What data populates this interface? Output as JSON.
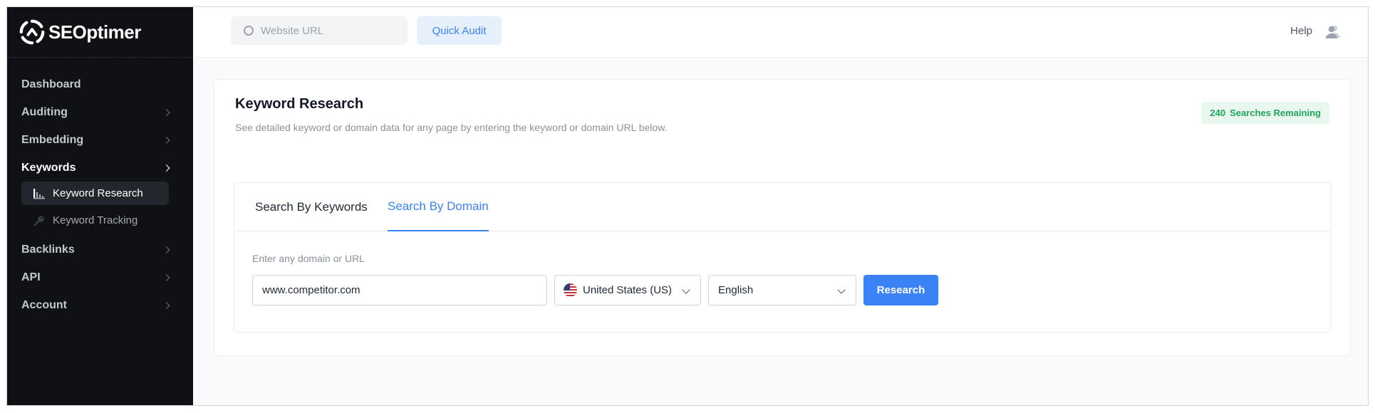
{
  "brand": {
    "name": "SEOptimer"
  },
  "topbar": {
    "url_placeholder": "Website URL",
    "quick_audit_label": "Quick Audit",
    "help_label": "Help"
  },
  "sidebar": {
    "items": [
      {
        "label": "Dashboard",
        "has_chevron": false
      },
      {
        "label": "Auditing",
        "has_chevron": true
      },
      {
        "label": "Embedding",
        "has_chevron": true
      },
      {
        "label": "Keywords",
        "has_chevron": true,
        "active": true
      },
      {
        "label": "Backlinks",
        "has_chevron": true
      },
      {
        "label": "API",
        "has_chevron": true
      },
      {
        "label": "Account",
        "has_chevron": true
      }
    ],
    "keywords_sub": [
      {
        "label": "Keyword Research",
        "icon": "bar-chart-icon",
        "active": true
      },
      {
        "label": "Keyword Tracking",
        "icon": "key-icon",
        "active": false
      }
    ]
  },
  "main": {
    "title": "Keyword Research",
    "subtitle": "See detailed keyword or domain data for any page by entering the keyword or domain URL below.",
    "badge": {
      "count": "240",
      "label": "Searches Remaining",
      "color": "#22a55b"
    },
    "tabs": [
      {
        "label": "Search By Keywords",
        "active": false
      },
      {
        "label": "Search By Domain",
        "active": true
      }
    ],
    "form": {
      "field_label": "Enter any domain or URL",
      "domain_value": "www.competitor.com",
      "country": "United States (US)",
      "language": "English",
      "submit_label": "Research"
    }
  },
  "colors": {
    "accent": "#3b82f6",
    "sidebar_bg": "#0f1115"
  }
}
